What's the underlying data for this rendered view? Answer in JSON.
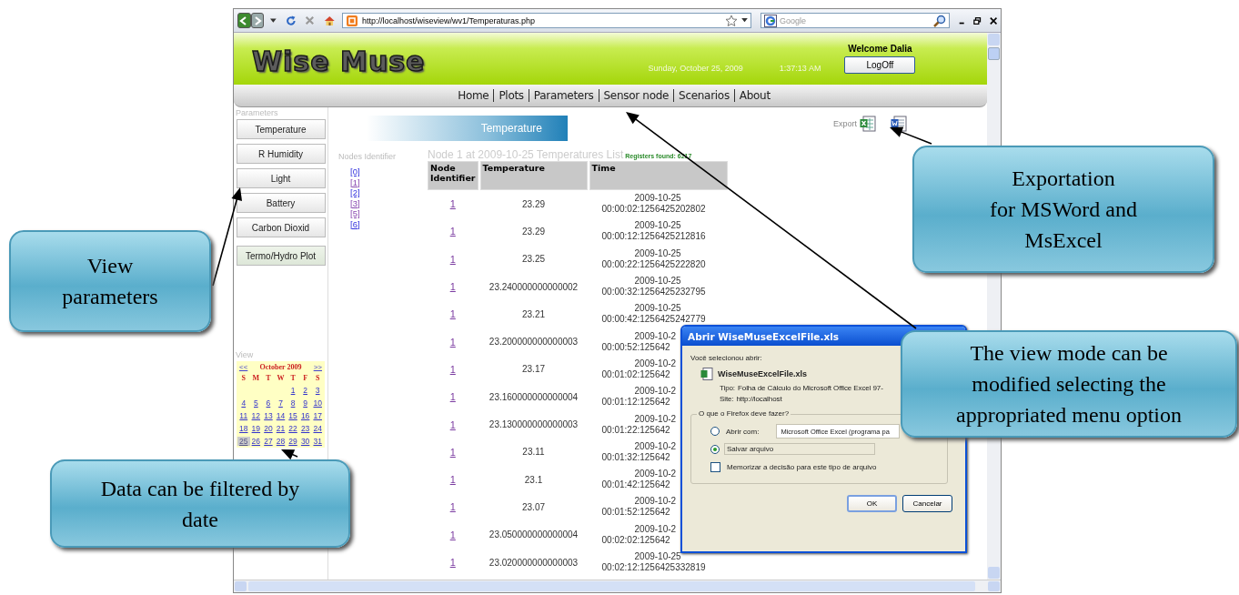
{
  "browser": {
    "url": "http://localhost/wiseview/wv1/Temperaturas.php",
    "search_placeholder": "Google"
  },
  "header": {
    "logo": "Wise Muse",
    "date": "Sunday, October 25, 2009",
    "time": "1:37:13 AM",
    "welcome": "Welcome Dalia",
    "logoff": "LogOff"
  },
  "nav": [
    {
      "label": "Home"
    },
    {
      "label": "Plots"
    },
    {
      "label": "Parameters"
    },
    {
      "label": "Sensor node"
    },
    {
      "label": "Scenarios"
    },
    {
      "label": "About"
    }
  ],
  "sidebar": {
    "parameters_label": "Parameters",
    "buttons": [
      {
        "label": "Temperature",
        "kind": "parameter"
      },
      {
        "label": "R Humidity",
        "kind": "parameter"
      },
      {
        "label": "Light",
        "kind": "parameter"
      },
      {
        "label": "Battery",
        "kind": "parameter"
      },
      {
        "label": "Carbon Dioxid",
        "kind": "parameter"
      },
      {
        "label": "Termo/Hydro Plot",
        "kind": "plot"
      }
    ],
    "view_label": "View",
    "calendar": {
      "prev": "<<",
      "month": "October 2009",
      "next": ">>",
      "weekdays": [
        "S",
        "M",
        "T",
        "W",
        "T",
        "F",
        "S"
      ],
      "weeks": [
        [
          {
            "d": "1",
            "selected": false
          },
          {
            "d": "2",
            "selected": false
          },
          {
            "d": "3",
            "selected": false
          }
        ],
        [
          {
            "d": "4",
            "selected": false
          },
          {
            "d": "5",
            "selected": false
          },
          {
            "d": "6",
            "selected": false
          },
          {
            "d": "7",
            "selected": false
          },
          {
            "d": "8",
            "selected": false
          },
          {
            "d": "9",
            "selected": false
          },
          {
            "d": "10",
            "selected": false
          }
        ],
        [
          {
            "d": "11",
            "selected": false
          },
          {
            "d": "12",
            "selected": false
          },
          {
            "d": "13",
            "selected": false
          },
          {
            "d": "14",
            "selected": false
          },
          {
            "d": "15",
            "selected": false
          },
          {
            "d": "16",
            "selected": false
          },
          {
            "d": "17",
            "selected": false
          }
        ],
        [
          {
            "d": "18",
            "selected": false
          },
          {
            "d": "19",
            "selected": false
          },
          {
            "d": "20",
            "selected": false
          },
          {
            "d": "21",
            "selected": false
          },
          {
            "d": "22",
            "selected": false
          },
          {
            "d": "23",
            "selected": false
          },
          {
            "d": "24",
            "selected": false
          }
        ],
        [
          {
            "d": "25",
            "selected": true
          },
          {
            "d": "26",
            "selected": false
          },
          {
            "d": "27",
            "selected": false
          },
          {
            "d": "28",
            "selected": false
          },
          {
            "d": "29",
            "selected": false
          },
          {
            "d": "30",
            "selected": false
          },
          {
            "d": "31",
            "selected": false
          }
        ]
      ]
    }
  },
  "nodes": {
    "label": "Nodes Identifier",
    "items": [
      {
        "label": "[0]",
        "visited": false
      },
      {
        "label": "[1]",
        "visited": true
      },
      {
        "label": "[2]",
        "visited": false
      },
      {
        "label": "[3]",
        "visited": true
      },
      {
        "label": "[5]",
        "visited": true
      },
      {
        "label": "[6]",
        "visited": false
      }
    ]
  },
  "main": {
    "banner": "Temperature",
    "export_label": "Export",
    "list_title": "Node 1 at 2009-10-25 Temperatures List",
    "registers": "Registers found: 6217",
    "table": {
      "columns": [
        "Node Identifier",
        "Temperature",
        "Time"
      ],
      "rows": [
        {
          "node": "1",
          "temperature": "23.29",
          "date": "2009-10-25",
          "time": "00:00:02:1256425202802"
        },
        {
          "node": "1",
          "temperature": "23.29",
          "date": "2009-10-25",
          "time": "00:00:12:1256425212816"
        },
        {
          "node": "1",
          "temperature": "23.25",
          "date": "2009-10-25",
          "time": "00:00:22:1256425222820"
        },
        {
          "node": "1",
          "temperature": "23.240000000000002",
          "date": "2009-10-25",
          "time": "00:00:32:1256425232795"
        },
        {
          "node": "1",
          "temperature": "23.21",
          "date": "2009-10-25",
          "time": "00:00:42:1256425242779"
        },
        {
          "node": "1",
          "temperature": "23.200000000000003",
          "date": "2009-10-2",
          "time": "00:00:52:125642"
        },
        {
          "node": "1",
          "temperature": "23.17",
          "date": "2009-10-2",
          "time": "00:01:02:125642"
        },
        {
          "node": "1",
          "temperature": "23.160000000000004",
          "date": "2009-10-2",
          "time": "00:01:12:125642"
        },
        {
          "node": "1",
          "temperature": "23.130000000000003",
          "date": "2009-10-2",
          "time": "00:01:22:125642"
        },
        {
          "node": "1",
          "temperature": "23.11",
          "date": "2009-10-2",
          "time": "00:01:32:125642"
        },
        {
          "node": "1",
          "temperature": "23.1",
          "date": "2009-10-2",
          "time": "00:01:42:125642"
        },
        {
          "node": "1",
          "temperature": "23.07",
          "date": "2009-10-2",
          "time": "00:01:52:125642"
        },
        {
          "node": "1",
          "temperature": "23.050000000000004",
          "date": "2009-10-2",
          "time": "00:02:02:125642"
        },
        {
          "node": "1",
          "temperature": "23.020000000000003",
          "date": "2009-10-25",
          "time": "00:02:12:1256425332819"
        }
      ]
    }
  },
  "dialog": {
    "title": "Abrir WiseMuseExcelFile.xls",
    "intro": "Você selecionou abrir:",
    "file": "WiseMuseExcelFile.xls",
    "type_label": "Tipo:",
    "type_value": "Folha de Cálculo do Microsoft Office Excel 97-",
    "site_label": "Site:",
    "site_value": "http://localhost",
    "group": "O que o Firefox deve fazer?",
    "options": [
      {
        "label": "Abrir com:",
        "selected": false,
        "app": "Microsoft Office Excel (programa pa"
      },
      {
        "label": "Salvar arquivo",
        "selected": true
      }
    ],
    "remember": {
      "label": "Memorizar a decisão para este tipo de arquivo",
      "checked": false
    },
    "buttons": [
      "OK",
      "Cancelar"
    ]
  },
  "callouts": [
    {
      "text": "View\nparameters"
    },
    {
      "text": "Data can be filtered by\ndate"
    },
    {
      "text": "Exportation\nfor MSWord and\nMsExcel"
    },
    {
      "text": "The view mode can be\nmodified selecting the\nappropriated menu option"
    }
  ]
}
